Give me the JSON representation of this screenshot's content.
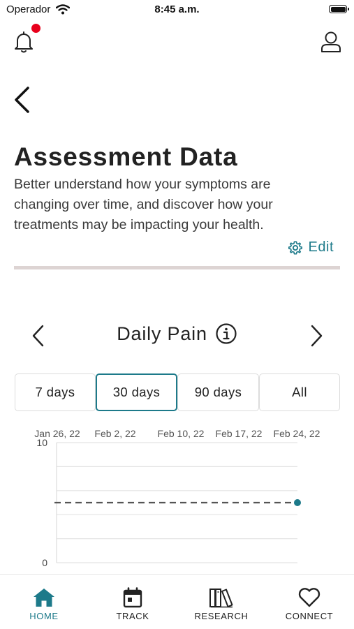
{
  "status_bar": {
    "carrier": "Operador",
    "time": "8:45 a.m."
  },
  "header": {
    "notification_icon": "bell-icon",
    "notification_badge_color": "#e8001c",
    "profile_icon": "user-icon"
  },
  "page": {
    "back_icon": "chevron-left-icon",
    "title": "Assessment Data",
    "description": "Better understand how your symptoms are changing over time, and discover how your treatments may be impacting your health.",
    "edit_label": "Edit",
    "edit_icon": "gear-icon"
  },
  "chart_section": {
    "title": "Daily Pain",
    "info_icon": "info-icon",
    "prev_icon": "chevron-left-icon",
    "next_icon": "chevron-right-icon",
    "range_tabs": [
      {
        "label": "7 days",
        "active": false
      },
      {
        "label": "30 days",
        "active": true
      },
      {
        "label": "90 days",
        "active": false
      },
      {
        "label": "All",
        "active": false
      }
    ]
  },
  "chart_data": {
    "type": "line",
    "x_ticks": [
      "Jan 26, 22",
      "Feb 2, 22",
      "Feb 10, 22",
      "Feb 17, 22",
      "Feb 24, 22"
    ],
    "x_range": [
      "2022-01-26",
      "2022-02-25"
    ],
    "ylim": [
      0,
      10
    ],
    "y_ticks": [
      0,
      10
    ],
    "series": [
      {
        "points": [
          {
            "x": "2022-02-25",
            "y": 5
          }
        ],
        "color": "#1d7a8a"
      }
    ],
    "reference_line": {
      "y": 5,
      "style": "dashed",
      "color": "#555555"
    },
    "grid": true
  },
  "bottom_nav": {
    "items": [
      {
        "label": "HOME",
        "icon": "home-icon",
        "active": true
      },
      {
        "label": "TRACK",
        "icon": "calendar-icon",
        "active": false
      },
      {
        "label": "RESEARCH",
        "icon": "books-icon",
        "active": false
      },
      {
        "label": "CONNECT",
        "icon": "heart-icon",
        "active": false
      }
    ]
  },
  "colors": {
    "accent": "#1d7a8a",
    "divider": "#ddd4d3"
  }
}
